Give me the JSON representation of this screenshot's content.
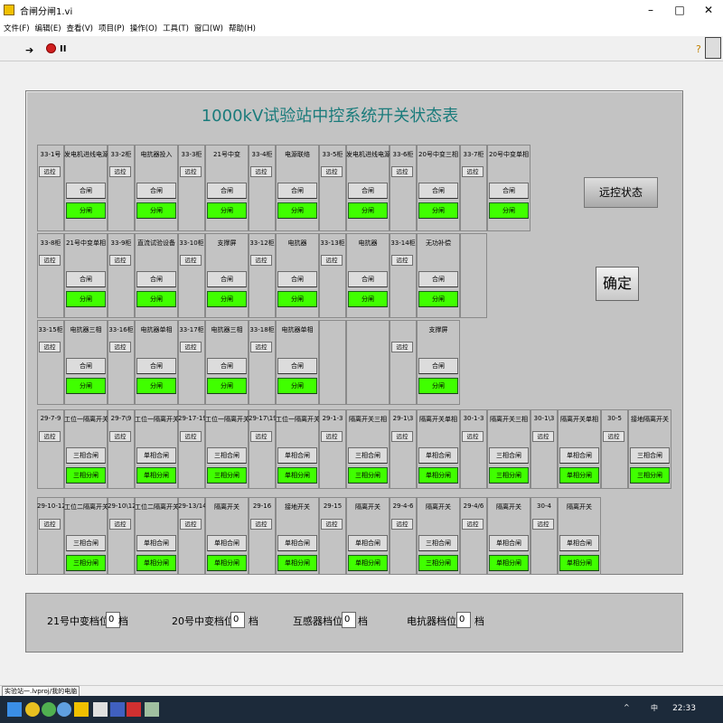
{
  "window": {
    "title": "合闸分闸1.vi",
    "minimize": "–",
    "maximize": "□",
    "close": "✕"
  },
  "menu": [
    "文件(F)",
    "编辑(E)",
    "查看(V)",
    "项目(P)",
    "操作(O)",
    "工具(T)",
    "窗口(W)",
    "帮助(H)"
  ],
  "toolbar": {
    "run_icon": "run-arrow-icon",
    "stop_icon": "abort-icon",
    "pause_icon": "pause-icon",
    "help_icon": "help-icon",
    "pause_glyph": "II",
    "help_glyph": "?"
  },
  "panel": {
    "title": "1000kV试验站中控系统开关状态表",
    "remote_status_button": "远控状态",
    "confirm_button": "确定"
  },
  "rows": [
    {
      "cells": [
        {
          "label": "33-1号",
          "remote": "远控",
          "close": null,
          "open": null
        },
        {
          "label": "发电机进线电源",
          "remote": null,
          "close": "合闸",
          "open": "分闸"
        },
        {
          "label": "33-2柜",
          "remote": "远控",
          "close": null,
          "open": null
        },
        {
          "label": "电抗器投入",
          "remote": null,
          "close": "合闸",
          "open": "分闸"
        },
        {
          "label": "33-3柜",
          "remote": "远控",
          "close": null,
          "open": null
        },
        {
          "label": "21号中变",
          "remote": null,
          "close": "合闸",
          "open": "分闸"
        },
        {
          "label": "33-4柜",
          "remote": "远控",
          "close": null,
          "open": null
        },
        {
          "label": "电源联络",
          "remote": null,
          "close": "合闸",
          "open": "分闸"
        },
        {
          "label": "33-5柜",
          "remote": "远控",
          "close": null,
          "open": null
        },
        {
          "label": "发电机进线电源",
          "remote": null,
          "close": "合闸",
          "open": "分闸"
        },
        {
          "label": "33-6柜",
          "remote": "远控",
          "close": null,
          "open": null
        },
        {
          "label": "20号中变三相",
          "remote": null,
          "close": "合闸",
          "open": "分闸"
        },
        {
          "label": "33-7柜",
          "remote": "远控",
          "close": null,
          "open": null
        },
        {
          "label": "20号中变单相",
          "remote": null,
          "close": "合闸",
          "open": "分闸"
        }
      ]
    },
    {
      "cells": [
        {
          "label": "33-8柜",
          "remote": "远控",
          "close": null,
          "open": null
        },
        {
          "label": "21号中变单相",
          "remote": null,
          "close": "合闸",
          "open": "分闸"
        },
        {
          "label": "33-9柜",
          "remote": "远控",
          "close": null,
          "open": null
        },
        {
          "label": "直流试验设备",
          "remote": null,
          "close": "合闸",
          "open": "分闸"
        },
        {
          "label": "33-10柜",
          "remote": "远控",
          "close": null,
          "open": null
        },
        {
          "label": "支撑屏",
          "remote": null,
          "close": "合闸",
          "open": "分闸"
        },
        {
          "label": "33-12柜",
          "remote": "远控",
          "close": null,
          "open": null
        },
        {
          "label": "电抗器",
          "remote": null,
          "close": "合闸",
          "open": "分闸"
        },
        {
          "label": "33-13柜",
          "remote": "远控",
          "close": null,
          "open": null
        },
        {
          "label": "电抗器",
          "remote": null,
          "close": "合闸",
          "open": "分闸"
        },
        {
          "label": "33-14柜",
          "remote": "远控",
          "close": null,
          "open": null
        },
        {
          "label": "无功补偿",
          "remote": null,
          "close": "合闸",
          "open": "分闸"
        },
        {
          "label": "",
          "remote": null,
          "close": null,
          "open": null
        }
      ]
    },
    {
      "cells": [
        {
          "label": "33-15柜",
          "remote": "远控",
          "close": null,
          "open": null
        },
        {
          "label": "电抗器三相",
          "remote": null,
          "close": "合闸",
          "open": "分闸"
        },
        {
          "label": "33-16柜",
          "remote": "远控",
          "close": null,
          "open": null
        },
        {
          "label": "电抗器单相",
          "remote": null,
          "close": "合闸",
          "open": "分闸"
        },
        {
          "label": "33-17柜",
          "remote": "远控",
          "close": null,
          "open": null
        },
        {
          "label": "电抗器三相",
          "remote": null,
          "close": "合闸",
          "open": "分闸"
        },
        {
          "label": "33-18柜",
          "remote": "远控",
          "close": null,
          "open": null
        },
        {
          "label": "电抗器单相",
          "remote": null,
          "close": "合闸",
          "open": "分闸"
        },
        {
          "label": "",
          "remote": null,
          "close": null,
          "open": null
        },
        {
          "label": "",
          "remote": null,
          "close": null,
          "open": null
        },
        {
          "label": "",
          "remote": "远控",
          "close": null,
          "open": null
        },
        {
          "label": "支撑屏",
          "remote": null,
          "close": "合闸",
          "open": "分闸"
        }
      ]
    },
    {
      "cells": [
        {
          "label": "29-7-9",
          "remote": "远控",
          "close": null,
          "open": null
        },
        {
          "label": "工位一隔离开关",
          "remote": null,
          "close": "三相合闸",
          "open": "三相分闸"
        },
        {
          "label": "29-7\\9",
          "remote": "远控",
          "close": null,
          "open": null
        },
        {
          "label": "工位一隔离开关",
          "remote": null,
          "close": "单相合闸",
          "open": "单相分闸"
        },
        {
          "label": "29-17-19",
          "remote": "远控",
          "close": null,
          "open": null
        },
        {
          "label": "工位一隔离开关",
          "remote": null,
          "close": "三相合闸",
          "open": "三相分闸"
        },
        {
          "label": "29-17\\19",
          "remote": "远控",
          "close": null,
          "open": null
        },
        {
          "label": "工位一隔离开关",
          "remote": null,
          "close": "单相合闸",
          "open": "单相分闸"
        },
        {
          "label": "29-1-3",
          "remote": "远控",
          "close": null,
          "open": null
        },
        {
          "label": "隔离开关三相",
          "remote": null,
          "close": "三相合闸",
          "open": "三相分闸"
        },
        {
          "label": "29-1\\3",
          "remote": "远控",
          "close": null,
          "open": null
        },
        {
          "label": "隔离开关单相",
          "remote": null,
          "close": "单相合闸",
          "open": "单相分闸"
        },
        {
          "label": "30-1-3",
          "remote": "远控",
          "close": null,
          "open": null
        },
        {
          "label": "隔离开关三相",
          "remote": null,
          "close": "三相合闸",
          "open": "三相分闸"
        },
        {
          "label": "30-1\\3",
          "remote": "远控",
          "close": null,
          "open": null
        },
        {
          "label": "隔离开关单相",
          "remote": null,
          "close": "单相合闸",
          "open": "单相分闸"
        },
        {
          "label": "30-5",
          "remote": "远控",
          "close": null,
          "open": null
        },
        {
          "label": "接地隔离开关",
          "remote": null,
          "close": "三相合闸",
          "open": "三相分闸"
        }
      ]
    },
    {
      "cells": [
        {
          "label": "29-10-12",
          "remote": "远控",
          "close": null,
          "open": null
        },
        {
          "label": "工位二隔离开关",
          "remote": null,
          "close": "三相合闸",
          "open": "三相分闸"
        },
        {
          "label": "29-10\\12",
          "remote": "远控",
          "close": null,
          "open": null
        },
        {
          "label": "工位二隔离开关",
          "remote": null,
          "close": "单相合闸",
          "open": "单相分闸"
        },
        {
          "label": "29-13/14",
          "remote": "远控",
          "close": null,
          "open": null
        },
        {
          "label": "隔离开关",
          "remote": null,
          "close": "单相合闸",
          "open": "单相分闸"
        },
        {
          "label": "29-16",
          "remote": "远控",
          "close": null,
          "open": null
        },
        {
          "label": "接地开关",
          "remote": null,
          "close": "单相合闸",
          "open": "单相分闸"
        },
        {
          "label": "29-15",
          "remote": "远控",
          "close": null,
          "open": null
        },
        {
          "label": "隔离开关",
          "remote": null,
          "close": "单相合闸",
          "open": "单相分闸"
        },
        {
          "label": "29-4-6",
          "remote": "远控",
          "close": null,
          "open": null
        },
        {
          "label": "隔离开关",
          "remote": null,
          "close": "三相合闸",
          "open": "三相分闸"
        },
        {
          "label": "29-4/6",
          "remote": "远控",
          "close": null,
          "open": null
        },
        {
          "label": "隔离开关",
          "remote": null,
          "close": "单相合闸",
          "open": "单相分闸"
        },
        {
          "label": "30-4",
          "remote": "远控",
          "close": null,
          "open": null
        },
        {
          "label": "隔离开关",
          "remote": null,
          "close": "单相合闸",
          "open": "单相分闸"
        }
      ]
    }
  ],
  "gears": [
    {
      "label": "21号中变档位",
      "value": "0",
      "unit": "档"
    },
    {
      "label": "20号中变档位",
      "value": "0",
      "unit": "档"
    },
    {
      "label": "互感器档位",
      "value": "0",
      "unit": "档"
    },
    {
      "label": "电抗器档位",
      "value": "0",
      "unit": "档"
    }
  ],
  "status_bar": {
    "text": "实验站一.lvproj/我的电脑"
  },
  "taskbar": {
    "time": "22:33",
    "lang": "中",
    "tray_glyph": "^"
  },
  "colors": {
    "title": "#1a7b7b",
    "open_button": "#40ff00",
    "panel": "#c3c3c3"
  }
}
